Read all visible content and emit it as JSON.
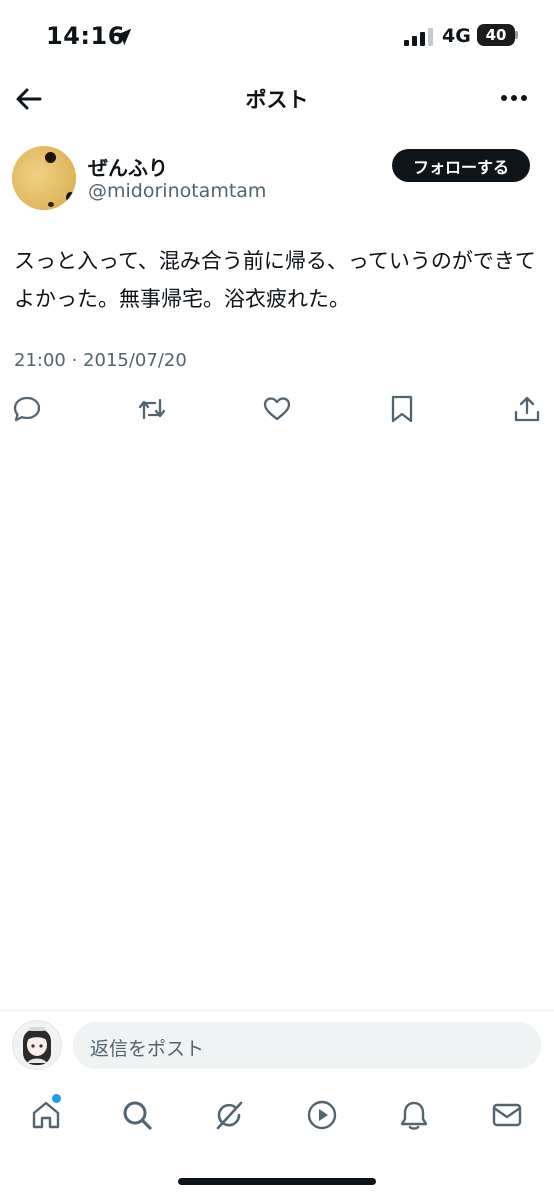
{
  "status_bar": {
    "time": "14:16",
    "network": "4G",
    "battery": "40"
  },
  "header": {
    "title": "ポスト"
  },
  "author": {
    "display_name": "ぜんふり",
    "handle": "@midorinotamtam",
    "follow_label": "フォローする"
  },
  "tweet": {
    "text": "スっと入って、混み合う前に帰る、っていうのができてよかった。無事帰宅。浴衣疲れた。",
    "timestamp": "21:00 · 2015/07/20"
  },
  "actions": [
    "reply-icon",
    "retweet-icon",
    "like-icon",
    "bookmark-icon",
    "share-icon"
  ],
  "reply": {
    "placeholder": "返信をポスト"
  },
  "tabbar": [
    "home-icon",
    "search-icon",
    "grok-icon",
    "video-icon",
    "notifications-icon",
    "messages-icon"
  ],
  "colors": {
    "text": "#0f1419",
    "secondary": "#536471",
    "accent": "#1d9bf0"
  }
}
